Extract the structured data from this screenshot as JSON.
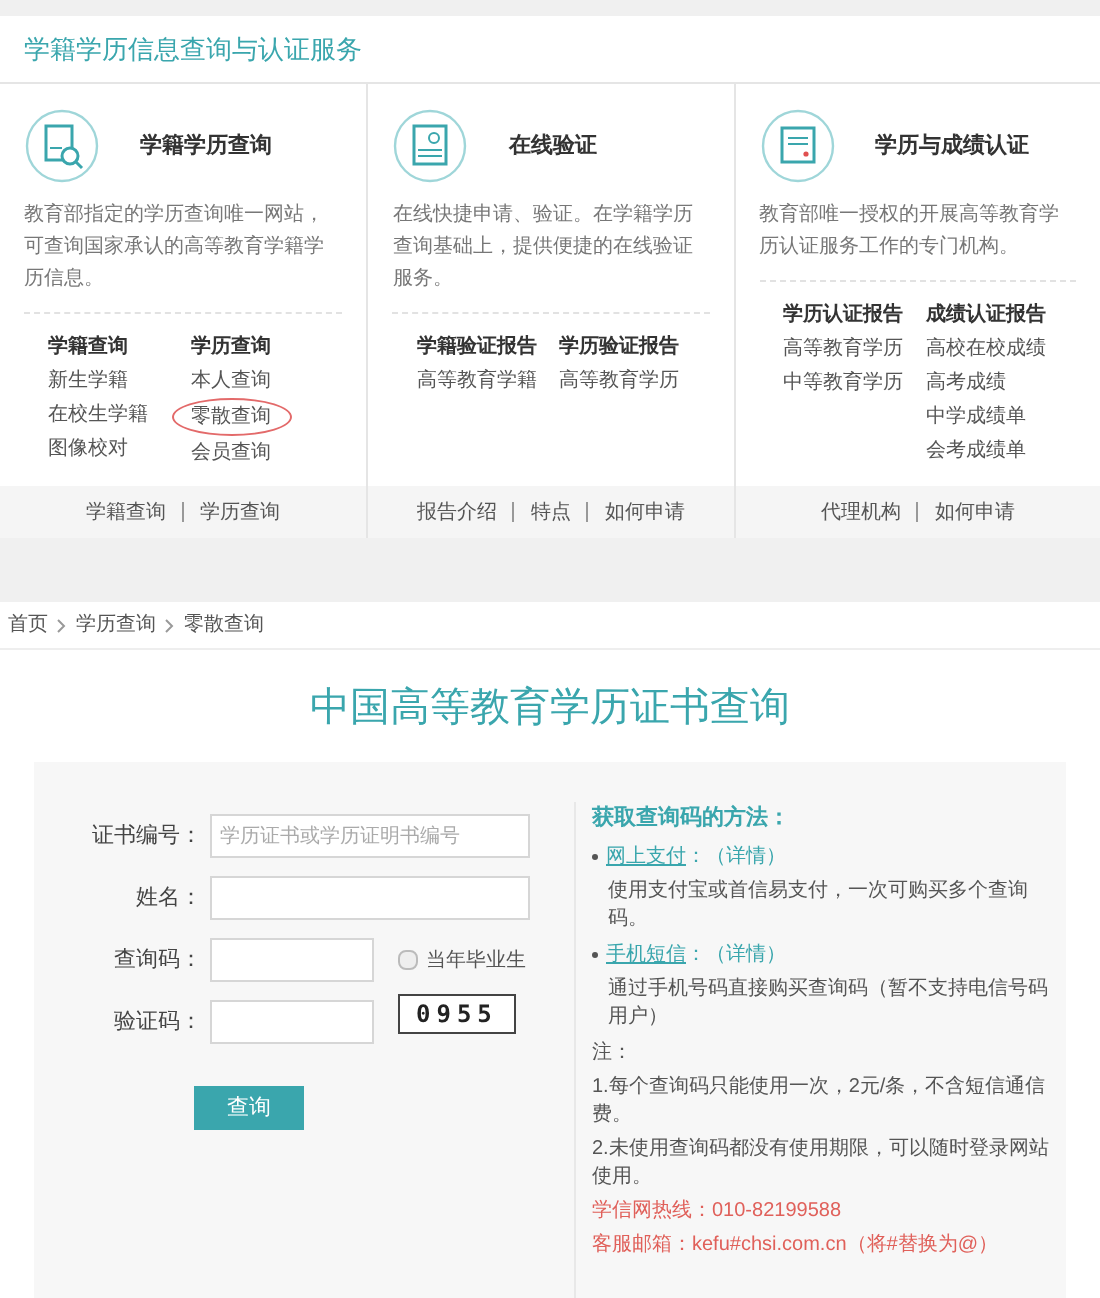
{
  "header": {
    "title": "学籍学历信息查询与认证服务"
  },
  "services": [
    {
      "title": "学籍学历查询",
      "kind": "query",
      "description": "教育部指定的学历查询唯一网站，可查询国家承认的高等教育学籍学历信息。",
      "groups": [
        {
          "heading": "学籍查询",
          "links": [
            {
              "label": "新生学籍",
              "circled": false
            },
            {
              "label": "在校生学籍",
              "circled": false
            },
            {
              "label": "图像校对",
              "circled": false
            }
          ]
        },
        {
          "heading": "学历查询",
          "links": [
            {
              "label": "本人查询",
              "circled": false
            },
            {
              "label": "零散查询",
              "circled": true
            },
            {
              "label": "会员查询",
              "circled": false
            }
          ]
        }
      ],
      "footer_links": [
        "学籍查询",
        "学历查询"
      ]
    },
    {
      "title": "在线验证",
      "kind": "verification",
      "description": "在线快捷申请、验证。在学籍学历查询基础上，提供便捷的在线验证服务。",
      "groups": [
        {
          "heading": "学籍验证报告",
          "links": [
            {
              "label": "高等教育学籍",
              "circled": false
            }
          ]
        },
        {
          "heading": "学历验证报告",
          "links": [
            {
              "label": "高等教育学历",
              "circled": false
            }
          ]
        }
      ],
      "footer_links": [
        "报告介绍",
        "特点",
        "如何申请"
      ]
    },
    {
      "title": "学历与成绩认证",
      "kind": "certification",
      "description": "教育部唯一授权的开展高等教育学历认证服务工作的专门机构。",
      "groups": [
        {
          "heading": "学历认证报告",
          "links": [
            {
              "label": "高等教育学历",
              "circled": false
            },
            {
              "label": "中等教育学历",
              "circled": false
            }
          ]
        },
        {
          "heading": "成绩认证报告",
          "links": [
            {
              "label": "高校在校成绩",
              "circled": false
            },
            {
              "label": "高考成绩",
              "circled": false
            },
            {
              "label": "中学成绩单",
              "circled": false
            },
            {
              "label": "会考成绩单",
              "circled": false
            }
          ]
        }
      ],
      "footer_links": [
        "代理机构",
        "如何申请"
      ]
    }
  ],
  "breadcrumb": [
    "首页",
    "学历查询",
    "零散查询"
  ],
  "page_title": "中国高等教育学历证书查询",
  "form": {
    "fields": [
      {
        "kind": "text",
        "label": "证书编号：",
        "placeholder": "学历证书或学历证明书编号"
      },
      {
        "kind": "text",
        "label": "姓名："
      },
      {
        "kind": "with_checkbox",
        "label": "查询码：",
        "checkbox": {
          "label": "当年毕业生",
          "checked": false
        }
      },
      {
        "kind": "captcha",
        "label": "验证码：",
        "captcha": "0955"
      }
    ],
    "submit": "查询"
  },
  "info": {
    "heading": "获取查询码的方法：",
    "methods": [
      {
        "link": "网上支付",
        "detail": "：（详情）",
        "description": "使用支付宝或首信易支付，一次可购买多个查询码。"
      },
      {
        "link": "手机短信",
        "detail": "：（详情）",
        "description": "通过手机号码直接购买查询码（暂不支持电信号码用户）"
      }
    ],
    "note_label": "注：",
    "notes": [
      "1.每个查询码只能使用一次，2元/条，不含短信通信费。",
      "2.未使用查询码都没有使用期限，可以随时登录网站使用。"
    ],
    "contacts": [
      "学信网热线：010-82199588",
      "客服邮箱：kefu#chsi.com.cn（将#替换为@）"
    ]
  }
}
